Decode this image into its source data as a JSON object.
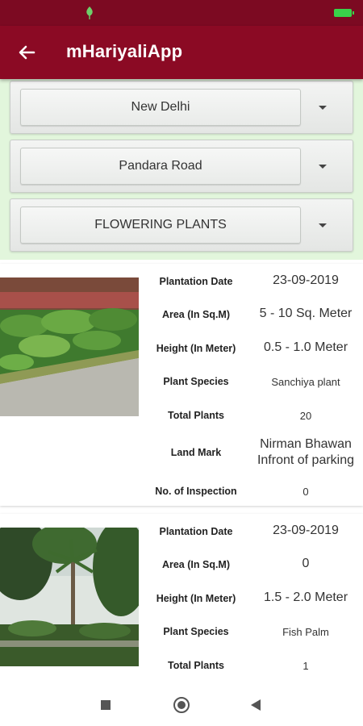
{
  "app_bar": {
    "title": "mHariyaliApp"
  },
  "filters": {
    "city": "New Delhi",
    "road": "Pandara Road",
    "category": "FLOWERING PLANTS"
  },
  "field_labels": {
    "plantation_date": "Plantation Date",
    "area": "Area (In Sq.M)",
    "height": "Height (In Meter)",
    "species": "Plant Species",
    "total_plants": "Total Plants",
    "land_mark": "Land Mark",
    "inspection": "No. of Inspection"
  },
  "records": [
    {
      "plantation_date": "23-09-2019",
      "area": "5 - 10 Sq. Meter",
      "height": "0.5 - 1.0 Meter",
      "species": "Sanchiya plant",
      "total_plants": "20",
      "land_mark_line1": "Nirman Bhawan",
      "land_mark_line2": "Infront of parking",
      "inspection": "0"
    },
    {
      "plantation_date": "23-09-2019",
      "area": "0",
      "height": "1.5 - 2.0 Meter",
      "species": "Fish Palm",
      "total_plants": "1"
    }
  ],
  "colors": {
    "app_bar": "#8b0a24",
    "status_bar": "#7c0a22",
    "filter_background": "#e2f6dc"
  },
  "icons": {
    "back": "arrow-left",
    "dropdown": "caret-down",
    "nav_recents": "square",
    "nav_home": "circle",
    "nav_back": "triangle-left"
  }
}
